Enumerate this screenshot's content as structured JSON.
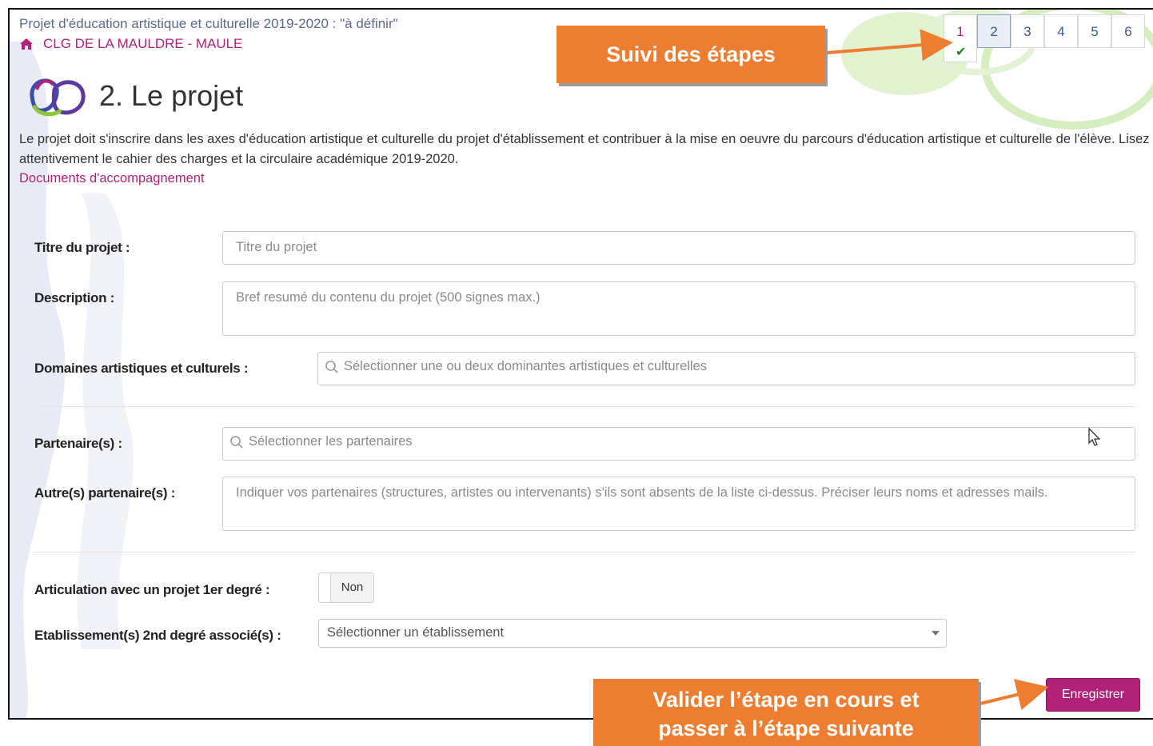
{
  "breadcrumb": "Projet d'éducation artistique et culturelle 2019-2020 : \"à définir\"",
  "school": {
    "name": "CLG DE LA MAULDRE - MAULE",
    "icon": "home-icon"
  },
  "page_title": "2. Le projet",
  "intro_text": "Le projet doit s'inscrire dans les axes d'éducation artistique et culturelle du projet d'établissement et contribuer à la mise en oeuvre du parcours d'éducation artistique et culturelle de l'élève. Lisez attentivement le cahier des charges et la circulaire académique 2019-2020.",
  "docs_link": "Documents d'accompagnement",
  "steps": [
    {
      "label": "1",
      "done": true
    },
    {
      "label": "2",
      "current": true
    },
    {
      "label": "3"
    },
    {
      "label": "4"
    },
    {
      "label": "5"
    },
    {
      "label": "6"
    }
  ],
  "form": {
    "title_label": "Titre du projet :",
    "title_placeholder": "Titre du projet",
    "description_label": "Description :",
    "description_placeholder": "Bref resumé du contenu du projet (500 signes max.)",
    "domains_label": "Domaines artistiques et culturels :",
    "domains_placeholder": "Sélectionner une ou deux dominantes artistiques et culturelles",
    "partners_label": "Partenaire(s) :",
    "partners_placeholder": "Sélectionner les partenaires",
    "other_partners_label": "Autre(s) partenaire(s) :",
    "other_partners_placeholder": "Indiquer vos partenaires (structures, artistes ou intervenants) s'ils sont absents de la liste ci-dessus. Préciser leurs noms et adresses mails.",
    "articulation_label": "Articulation avec un projet 1er degré :",
    "articulation_value": "Non",
    "establishment_label": "Etablissement(s) 2nd degré associé(s) :",
    "establishment_placeholder": "Sélectionner un établissement"
  },
  "save_button": "Enregistrer",
  "callouts": {
    "steps": "Suivi des étapes",
    "validate_line1": "Valider l’étape en cours et",
    "validate_line2": "passer à l’étape suivante"
  },
  "colors": {
    "accent": "#b0227a",
    "callout": "#ed7d31",
    "link": "#5a6b8a"
  }
}
